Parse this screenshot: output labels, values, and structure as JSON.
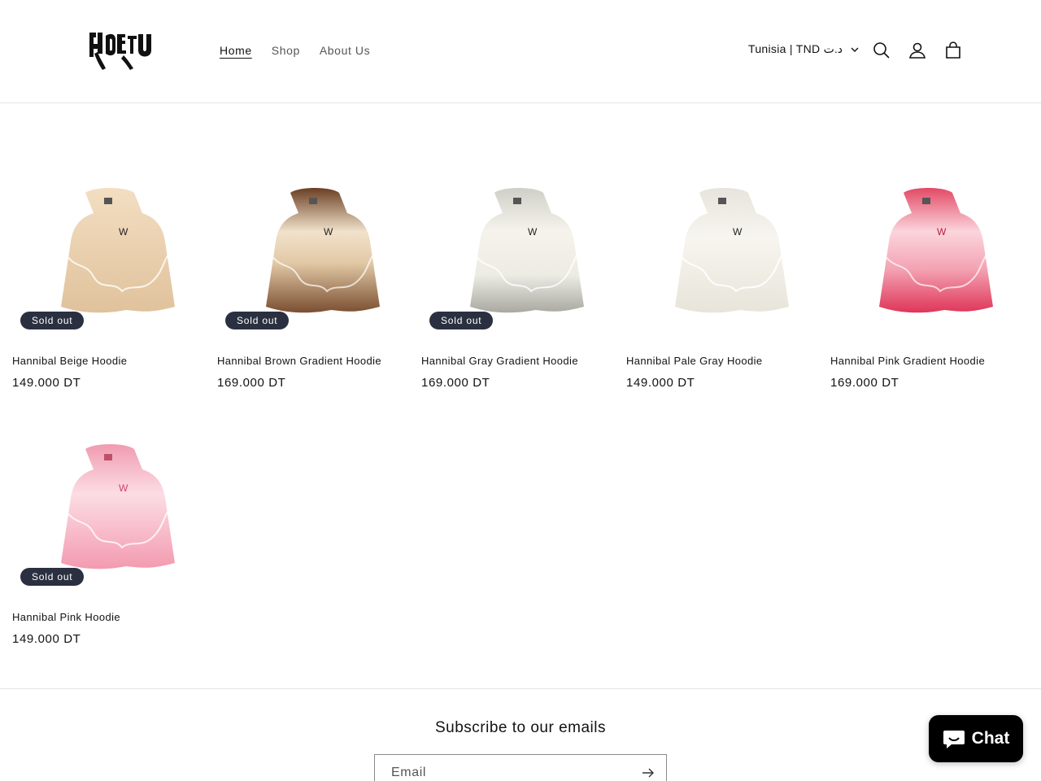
{
  "header": {
    "logo_alt": "store logo",
    "nav": [
      "Home",
      "Shop",
      "About Us"
    ],
    "country": "Tunisia | TND د.ت"
  },
  "products": [
    {
      "title": "Hannibal Beige Hoodie",
      "price": "149.000 DT",
      "badge": "Sold out",
      "color_top": "#e9d2b3",
      "color_bottom": "#f4e2c8"
    },
    {
      "title": "Hannibal Brown Gradient Hoodie",
      "price": "169.000 DT",
      "badge": "Sold out",
      "color_top": "#f1e2cb",
      "color_bottom": "#8a5a3b"
    },
    {
      "title": "Hannibal Gray Gradient Hoodie",
      "price": "169.000 DT",
      "badge": "Sold out",
      "color_top": "#f3f1ea",
      "color_bottom": "#b9b8b0"
    },
    {
      "title": "Hannibal Pale Gray Hoodie",
      "price": "149.000 DT",
      "badge": "",
      "color_top": "#f2efe6",
      "color_bottom": "#e6e2d8"
    },
    {
      "title": "Hannibal Pink Gradient Hoodie",
      "price": "169.000 DT",
      "badge": "",
      "color_top": "#f7c6cf",
      "color_bottom": "#e04363"
    },
    {
      "title": "Hannibal Pink Hoodie",
      "price": "149.000 DT",
      "badge": "Sold out",
      "color_top": "#f8d0d8",
      "color_bottom": "#f29bb0"
    }
  ],
  "footer": {
    "subscribe_title": "Subscribe to our emails",
    "email_placeholder": "Email"
  },
  "chat": {
    "label": "Chat"
  },
  "icons": [
    "search-icon",
    "account-icon",
    "cart-icon",
    "chevron-down-icon",
    "arrow-right-icon",
    "chat-bubble-icon"
  ]
}
